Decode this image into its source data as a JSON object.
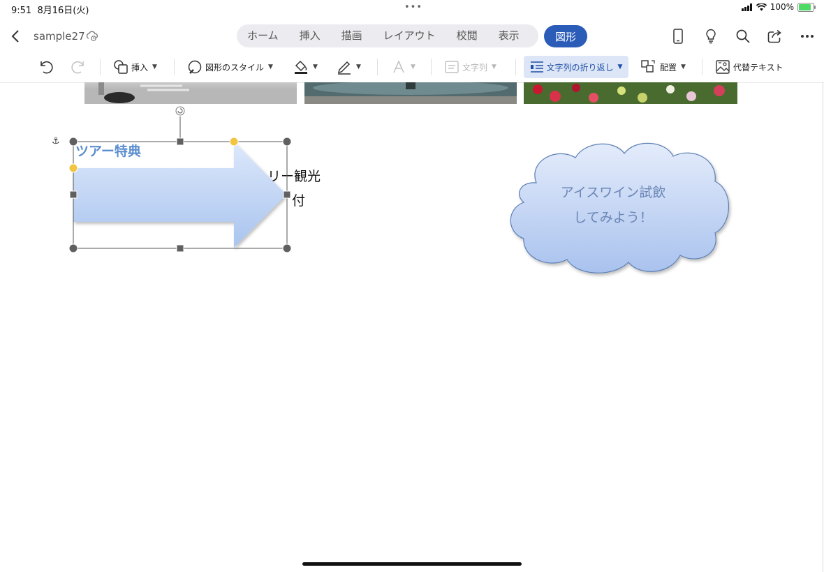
{
  "status_bar": {
    "time": "9:51",
    "date": "8月16日(火)",
    "center_dots": "•••",
    "battery": "100%"
  },
  "header": {
    "doc_title": "sample27",
    "tabs": [
      "ホーム",
      "挿入",
      "描画",
      "レイアウト",
      "校閲",
      "表示"
    ],
    "active_tab": "図形"
  },
  "ribbon": {
    "insert": "挿入",
    "shape_style": "図形のスタイル",
    "text_direction": "文字列",
    "wrap_text": "文字列の折り返し",
    "arrange": "配置",
    "alt_text": "代替テキスト"
  },
  "document": {
    "heading": "ツアー特典",
    "body_line1": "リー観光",
    "body_line2": "付",
    "cloud_text_line1": "アイスワイン試飲",
    "cloud_text_line2": "してみよう！"
  },
  "colors": {
    "accent": "#2b5cb8",
    "heading": "#5b8ed0",
    "shape_fill_top": "#dde8fb",
    "shape_fill_bottom": "#a9c4ee",
    "shape_outline": "#5b7fb3",
    "handle_yellow": "#f1c542"
  }
}
